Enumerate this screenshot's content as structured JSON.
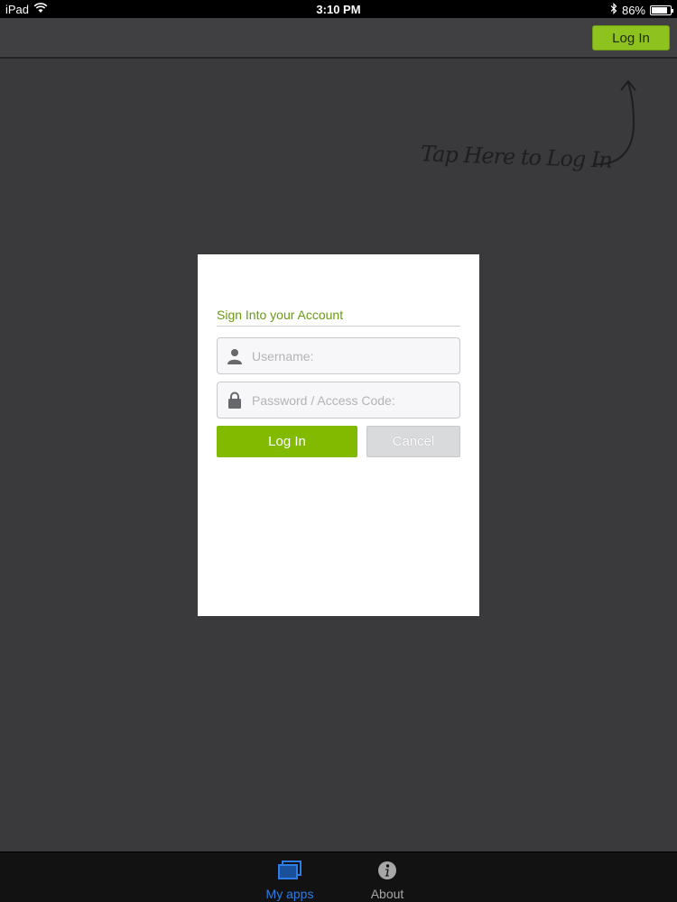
{
  "status_bar": {
    "carrier": "iPad",
    "time": "3:10 PM",
    "battery_text": "86%",
    "battery_level": 0.86,
    "icons": [
      "wifi-icon",
      "bluetooth-icon",
      "battery-icon"
    ]
  },
  "nav": {
    "login_label": "Log In"
  },
  "hint": {
    "text": "Tap Here to Log In",
    "arrow_icon": "curved-arrow-icon"
  },
  "dialog": {
    "title": "Sign Into your Account",
    "username": {
      "placeholder": "Username:",
      "value": "",
      "icon": "user-icon"
    },
    "password": {
      "placeholder": "Password / Access Code:",
      "value": "",
      "icon": "lock-icon"
    },
    "login_label": "Log In",
    "cancel_label": "Cancel"
  },
  "tab_bar": {
    "tabs": [
      {
        "label": "My apps",
        "icon": "stacked-screens-icon",
        "selected": true
      },
      {
        "label": "About",
        "icon": "info-icon",
        "selected": false
      }
    ]
  },
  "colors": {
    "accent_green": "#82ba00",
    "title_green": "#6a9a12",
    "tab_selected_blue": "#2e7ce6",
    "background": "#3a393b"
  }
}
